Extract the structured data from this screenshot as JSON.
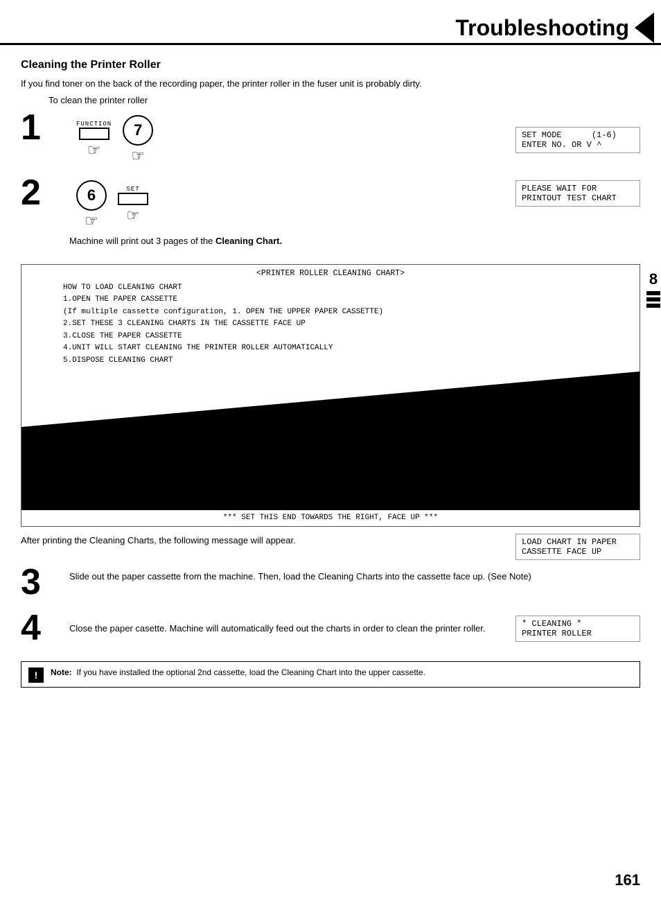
{
  "header": {
    "title": "Troubleshooting"
  },
  "section_number": "8",
  "page_number": "161",
  "section_heading": "Cleaning the Printer Roller",
  "intro_text": "If you find toner on the back of the recording paper, the printer roller in the fuser unit is probably dirty.",
  "to_clean": "To clean the printer roller",
  "steps": [
    {
      "num": "1",
      "function_label": "FUNCTION",
      "key_label": "7",
      "display_lines": [
        "SET MODE      (1-6)",
        "ENTER NO. OR V ^"
      ]
    },
    {
      "num": "2",
      "key_label": "6",
      "set_label": "SET",
      "display_lines": [
        "PLEASE WAIT FOR",
        "PRINTOUT TEST CHART"
      ],
      "description": "Machine will print out 3 pages of the Cleaning Chart."
    },
    {
      "num": "3",
      "text": "Slide out the paper cassette from the machine. Then, load the Cleaning Charts into the cassette face up. (See Note)"
    },
    {
      "num": "4",
      "text": "Close the paper casette. Machine will automatically feed out the charts in order to clean the printer roller.",
      "display_lines": [
        "* CLEANING *",
        "PRINTER ROLLER"
      ]
    }
  ],
  "chart": {
    "title": "<PRINTER ROLLER CLEANING CHART>",
    "instructions": [
      "HOW TO LOAD CLEANING CHART",
      "1.OPEN THE PAPER CASSETTE",
      "  (If multiple cassette configuration, 1. OPEN THE UPPER PAPER CASSETTE)",
      "2.SET THESE 3 CLEANING CHARTS IN THE CASSETTE FACE UP",
      "3.CLOSE THE PAPER CASSETTE",
      "4.UNIT WILL START CLEANING THE PRINTER ROLLER AUTOMATICALLY",
      "5.DISPOSE CLEANING CHART"
    ],
    "footer": "*** SET THIS END TOWARDS THE RIGHT, FACE UP ***"
  },
  "after_text": "After printing the Cleaning Charts, the following message will appear.",
  "after_display": [
    "LOAD CHART IN PAPER",
    "CASSETTE FACE UP"
  ],
  "note_text": "Note:  If you have installed the optional 2nd cassette, load the Cleaning Chart into the upper cassette."
}
